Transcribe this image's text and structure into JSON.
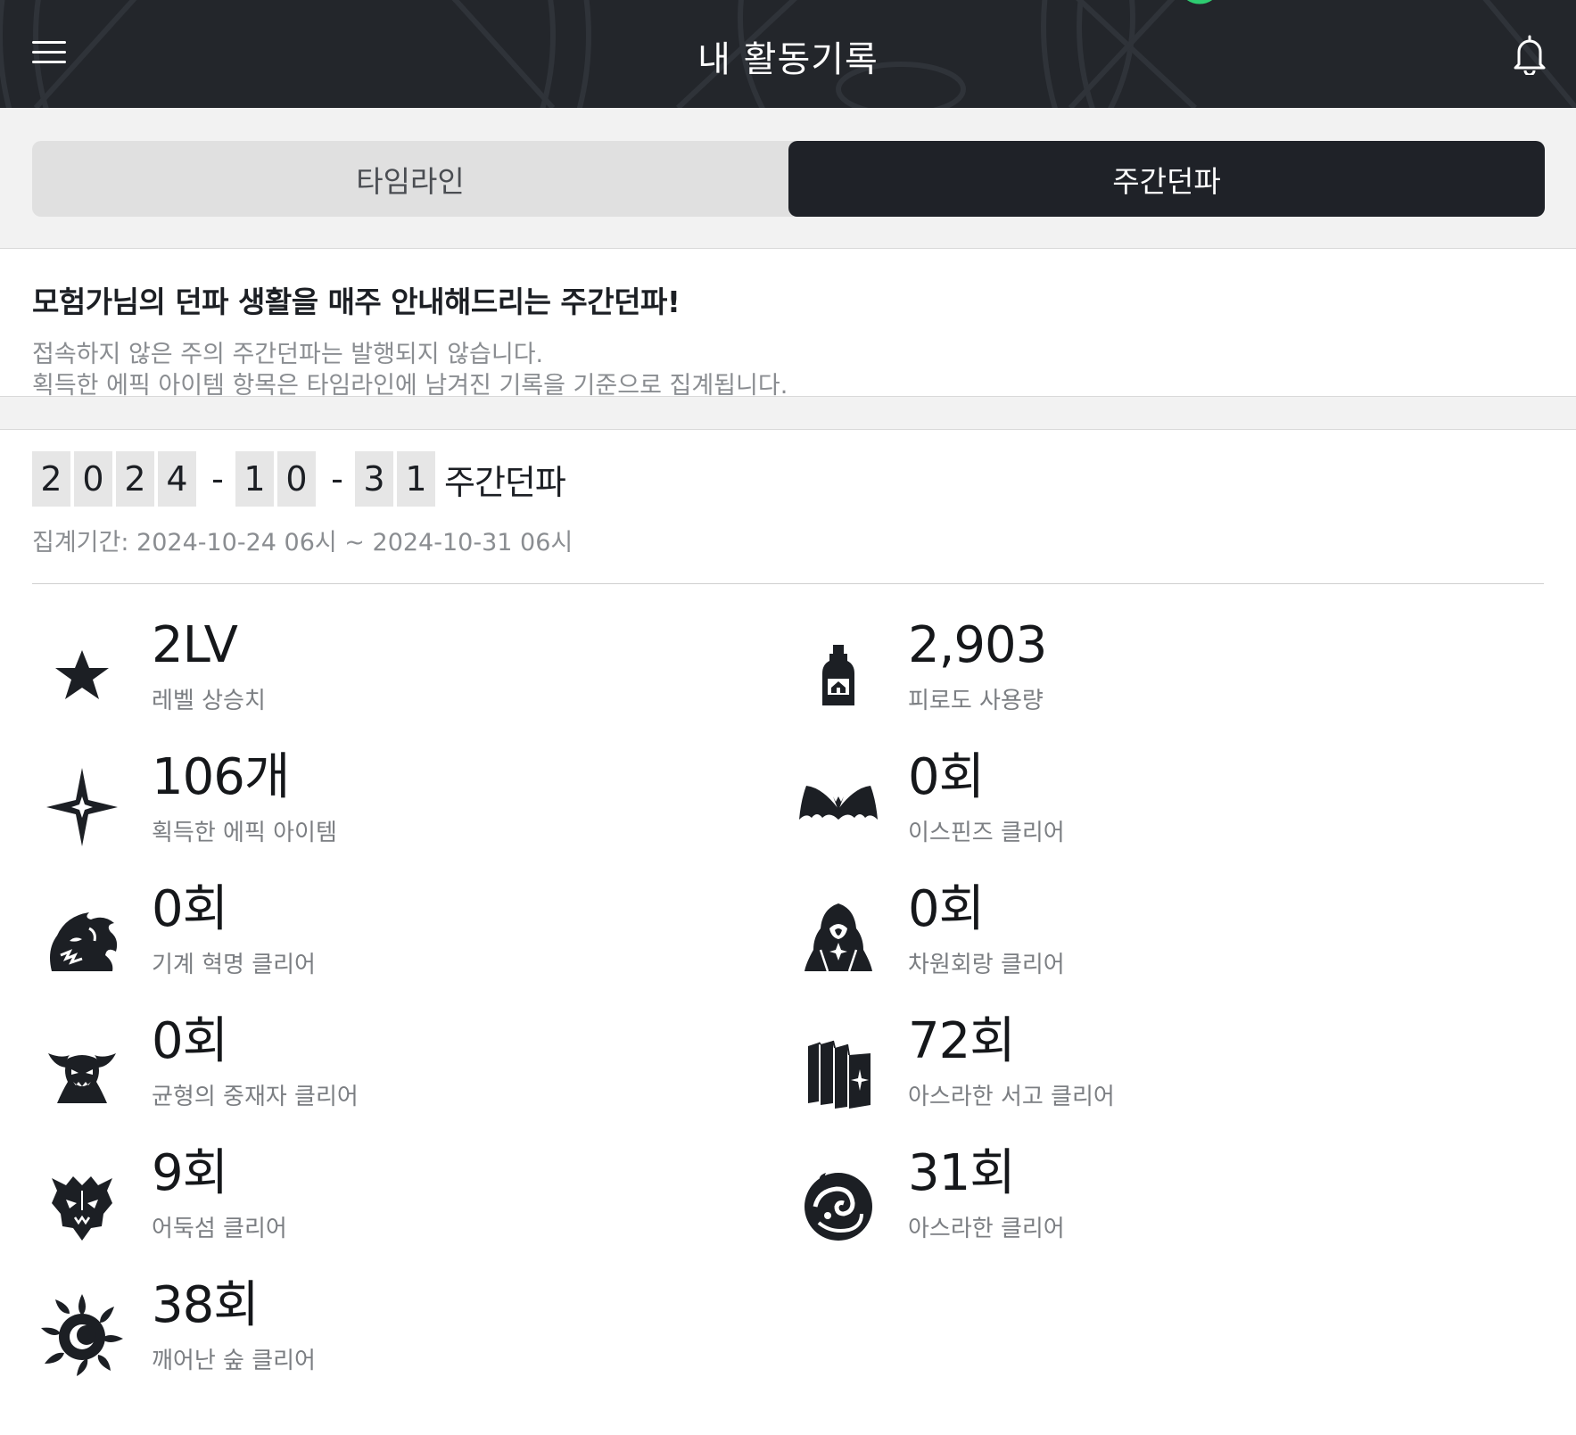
{
  "header": {
    "title": "내 활동기록"
  },
  "tabs": [
    {
      "label": "타임라인",
      "active": false
    },
    {
      "label": "주간던파",
      "active": true
    }
  ],
  "intro": {
    "title": "모험가님의 던파 생활을 매주 안내해드리는 주간던파!",
    "desc1": "접속하지 않은 주의 주간던파는 발행되지 않습니다.",
    "desc2": "획득한 에픽 아이템 항목은 타임라인에 남겨진 기록을 기준으로 집계됩니다."
  },
  "week": {
    "digits": [
      "2",
      "0",
      "2",
      "4",
      "-",
      "1",
      "0",
      "-",
      "3",
      "1"
    ],
    "label": "주간던파",
    "period": "집계기간: 2024-10-24 06시 ~ 2024-10-31 06시"
  },
  "stats": [
    {
      "value": "2LV",
      "label": "레벨 상승치",
      "icon": "star-icon"
    },
    {
      "value": "2,903",
      "label": "피로도 사용량",
      "icon": "potion-bottle-icon"
    },
    {
      "value": "106개",
      "label": "획득한 에픽 아이템",
      "icon": "sparkle-icon"
    },
    {
      "value": "0회",
      "label": "이스핀즈 클리어",
      "icon": "bat-wings-icon"
    },
    {
      "value": "0회",
      "label": "기계 혁명 클리어",
      "icon": "dragon-head-icon"
    },
    {
      "value": "0회",
      "label": "차원회랑 클리어",
      "icon": "hooded-figure-icon"
    },
    {
      "value": "0회",
      "label": "균형의 중재자 클리어",
      "icon": "horned-demon-icon"
    },
    {
      "value": "72회",
      "label": "아스라한 서고 클리어",
      "icon": "books-icon"
    },
    {
      "value": "9회",
      "label": "어둑섬 클리어",
      "icon": "demon-face-icon"
    },
    {
      "value": "31회",
      "label": "아스라한 클리어",
      "icon": "swirl-emblem-icon"
    },
    {
      "value": "38회",
      "label": "깨어난 숲 클리어",
      "icon": "dark-sun-icon"
    }
  ]
}
